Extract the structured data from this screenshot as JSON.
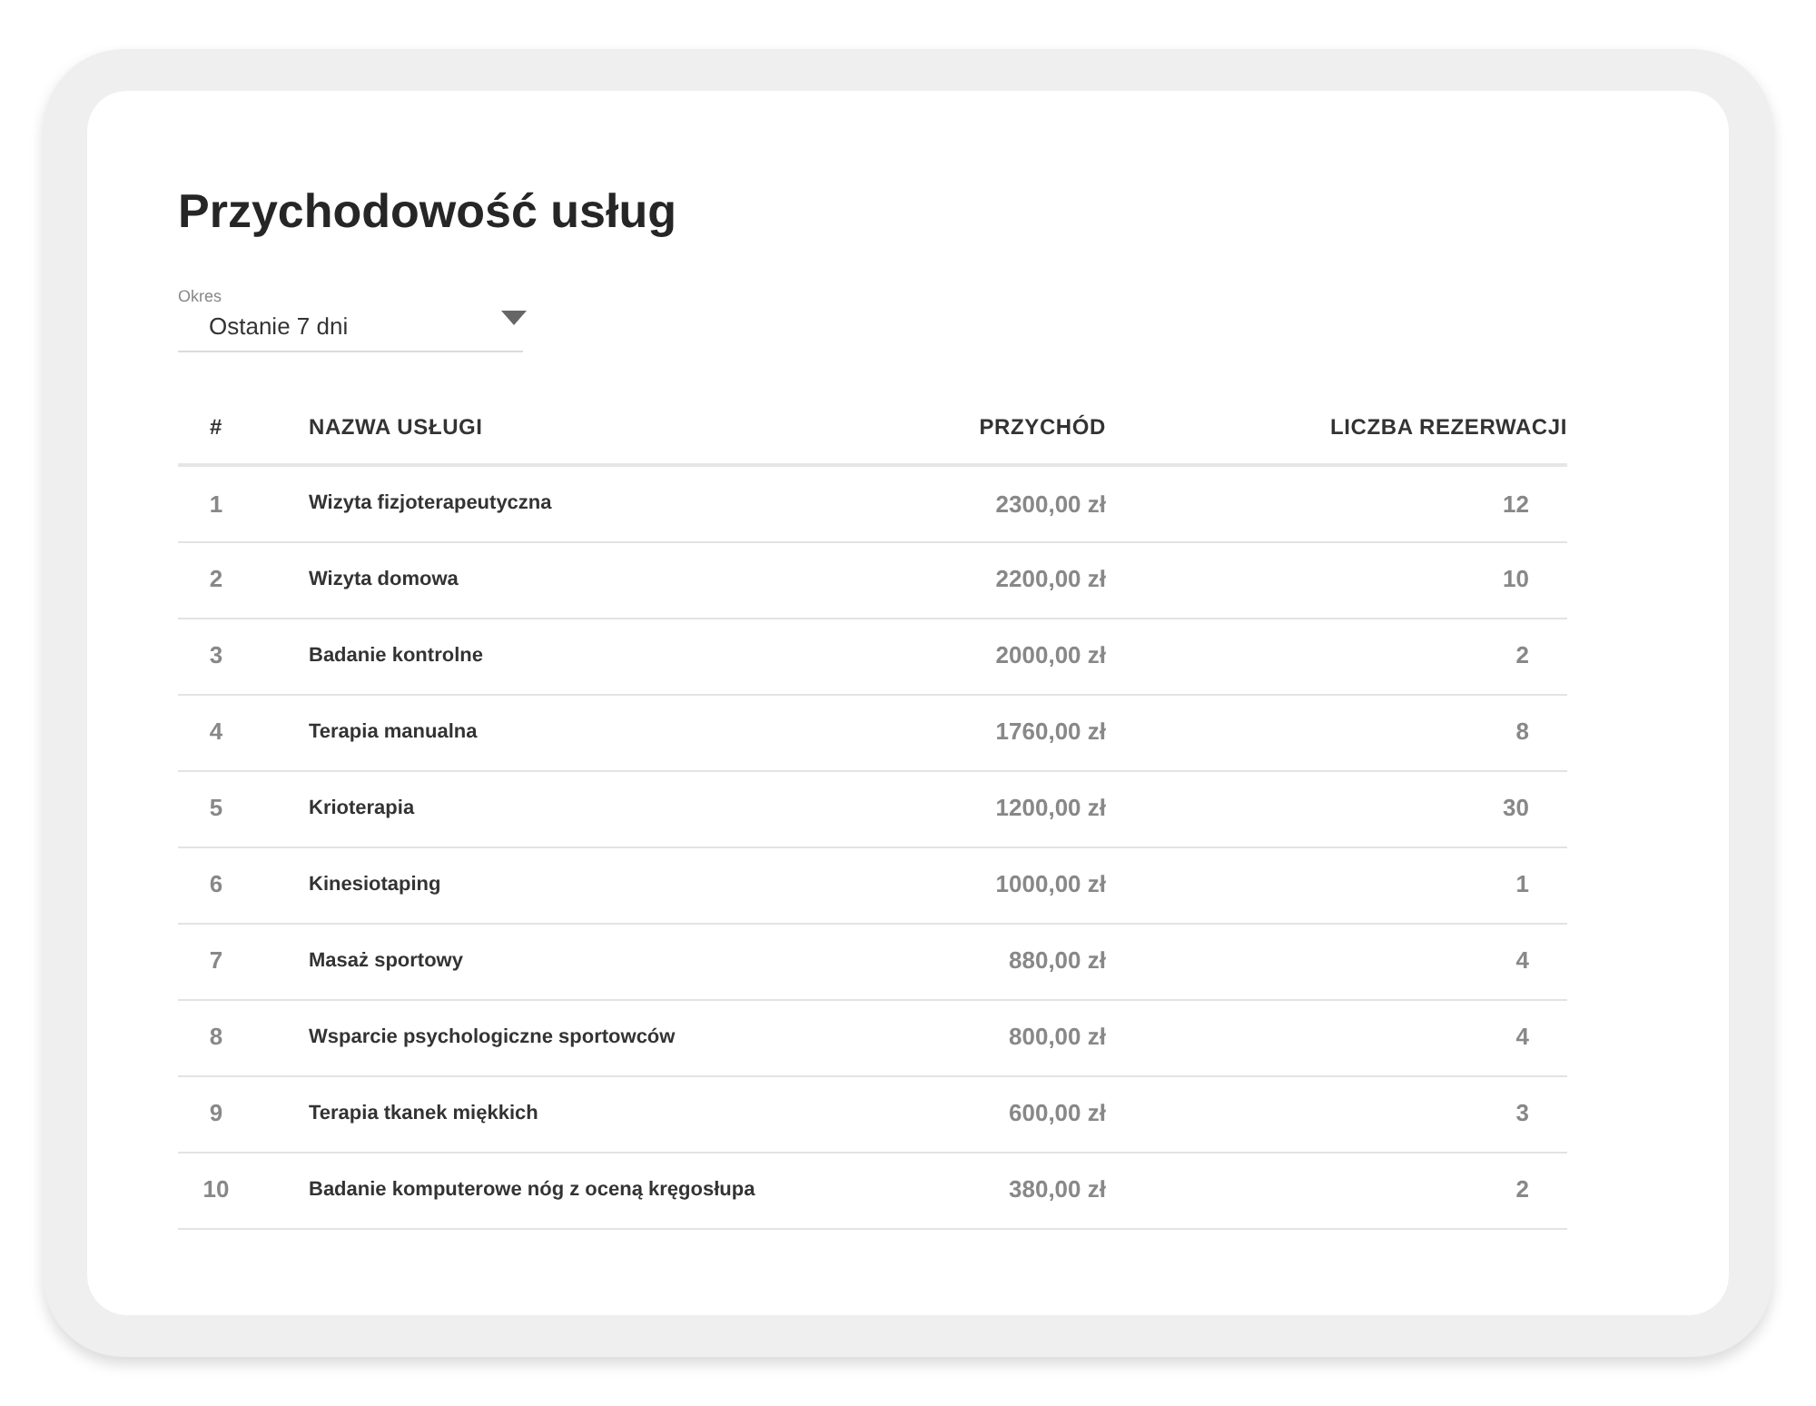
{
  "title": "Przychodowość usług",
  "period": {
    "label": "Okres",
    "value": "Ostanie 7 dni"
  },
  "table": {
    "columns": [
      "#",
      "NAZWA USŁUGI",
      "PRZYCHÓD",
      "LICZBA REZERWACJI"
    ],
    "rows": [
      [
        "1",
        "Wizyta fizjoterapeutyczna",
        "2300,00 zł",
        "12"
      ],
      [
        "2",
        "Wizyta domowa",
        "2200,00 zł",
        "10"
      ],
      [
        "3",
        "Badanie kontrolne",
        "2000,00 zł",
        "2"
      ],
      [
        "4",
        "Terapia manualna",
        "1760,00 zł",
        "8"
      ],
      [
        "5",
        "Krioterapia",
        "1200,00 zł",
        "30"
      ],
      [
        "6",
        "Kinesiotaping",
        "1000,00 zł",
        "1"
      ],
      [
        "7",
        "Masaż sportowy",
        "880,00 zł",
        "4"
      ],
      [
        "8",
        "Wsparcie psychologiczne sportowców",
        "800,00 zł",
        "4"
      ],
      [
        "9",
        "Terapia tkanek miękkich",
        "600,00 zł",
        "3"
      ],
      [
        "10",
        "Badanie komputerowe nóg z oceną kręgosłupa",
        "380,00 zł",
        "2"
      ]
    ]
  }
}
